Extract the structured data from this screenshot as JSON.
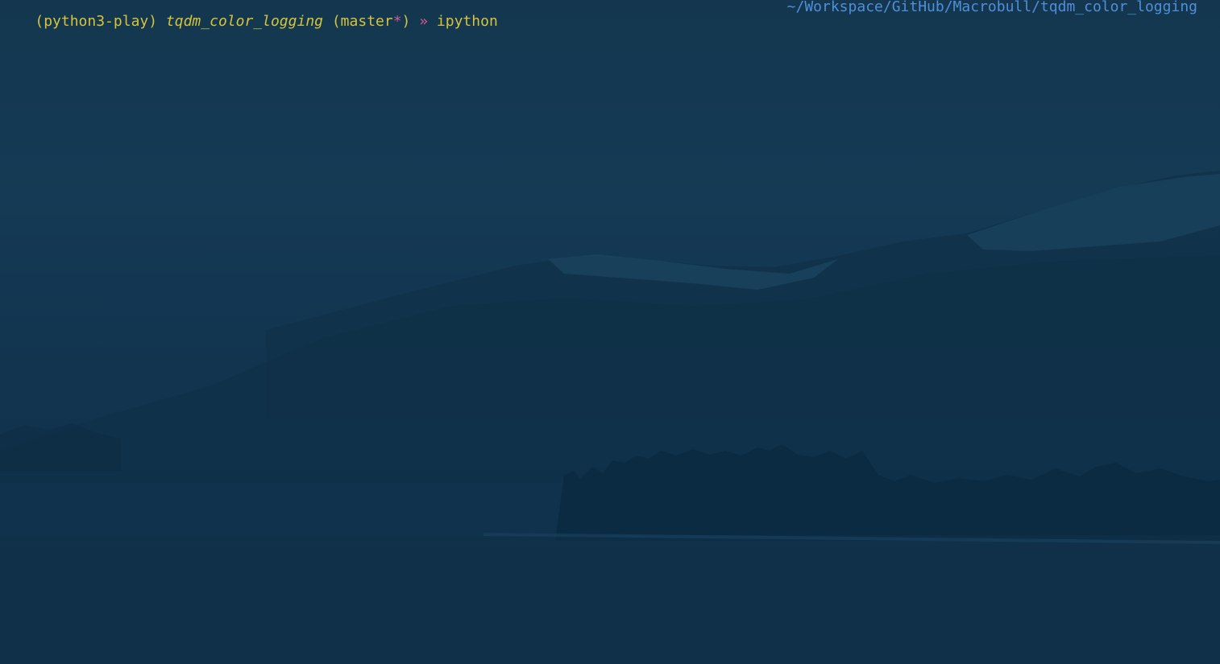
{
  "terminal": {
    "prompt": {
      "venv": "(python3-play)",
      "directory": "tqdm_color_logging",
      "branch_open": "(master",
      "dirty_marker": "*",
      "branch_close": ")",
      "arrow": "»",
      "command": "ipython"
    },
    "right_prompt_path": "~/Workspace/GitHub/Macrobull/tqdm_color_logging"
  },
  "theme": {
    "background": "#143a55",
    "prompt_color": "#d6c33c",
    "accent_color": "#d1589c",
    "path_color": "#4f8fd9"
  }
}
